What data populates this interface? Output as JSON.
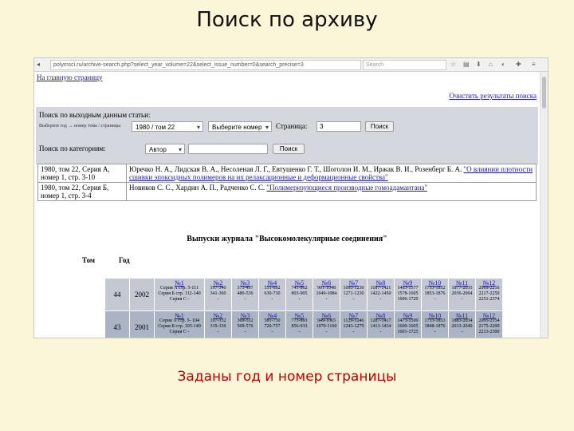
{
  "slide": {
    "title": "Поиск по архиву",
    "caption": "Заданы год и номер страницы"
  },
  "browser": {
    "url": "polymsci.ru/archive-search.php?select_year_volume=22&select_issue_number=0&search_precise=3",
    "search_placeholder": "Search"
  },
  "page": {
    "home_link": "На главную страницу",
    "clear_link": "Очистить результаты поиска",
    "output_search_label": "Поиск по выходным данным статьи:",
    "year_hint": "Выберите год → номер тома / страницы",
    "year_select": "1980 / том 22",
    "number_select": "Выберите номер",
    "page_label": "Страница:",
    "page_value": "3",
    "search_button": "Поиск",
    "category_label": "Поиск по категориям:",
    "category_select": "Автор",
    "category_input": "",
    "category_button": "Поиск"
  },
  "results": [
    {
      "ref": "1980, том 22, Серия А, номер 1, стр. 3-10",
      "authors": "Юречко Н. А., Лидская В. А., Несоленая Л. Г., Евтушенко Г. Т., Шоголон И. М., Иржак В. И., Розенберг Б. А.",
      "title": "\"О влиянии плотности сшивки эпоксидных полимеров на их релаксационные и деформационные свойства\""
    },
    {
      "ref": "1980, том 22, Серия Б, номер 1, стр. 3-4",
      "authors": "Новиков С. С., Хардин А. П., Радченко С. С.",
      "title": "\"Полимеризующиеся производные гомоадамантана\""
    }
  ],
  "issues": {
    "heading": "Выпуски журнала \"Высокомолекулярные соединения\"",
    "col_volume": "Том",
    "col_year": "Год",
    "rows": [
      {
        "volume": "44",
        "year": "2002",
        "cells": [
          {
            "no": "№1",
            "lines": [
              "Серия А стр. 5-111",
              "Серия Б стр. 112-140",
              "Серия С -"
            ]
          },
          {
            "no": "№2",
            "lines": [
              "197-340",
              "341-360",
              "-"
            ]
          },
          {
            "no": "№3",
            "lines": [
              "373-497",
              "480-536",
              "-"
            ]
          },
          {
            "no": "№4",
            "lines": [
              "551-692",
              "630-730",
              "-"
            ]
          },
          {
            "no": "№5",
            "lines": [
              "741-862",
              "803-905",
              "-"
            ]
          },
          {
            "no": "№6",
            "lines": [
              "901-1048",
              "1049-1084",
              "-"
            ]
          },
          {
            "no": "№7",
            "lines": [
              "1093-1230",
              "1271-1230",
              "-"
            ]
          },
          {
            "no": "№8",
            "lines": [
              "1187-1421",
              "1422-1450",
              "-"
            ]
          },
          {
            "no": "№9",
            "lines": [
              "1463-1577",
              "1578-1605",
              "1606-1720"
            ]
          },
          {
            "no": "№10",
            "lines": [
              "1733-1852",
              "1853-1876",
              "-"
            ]
          },
          {
            "no": "№11",
            "lines": [
              "1877-2035",
              "2036-2064",
              "-"
            ]
          },
          {
            "no": "№12",
            "lines": [
              "2069-2216",
              "2217-2250",
              "2251-2374"
            ]
          }
        ]
      },
      {
        "volume": "43",
        "year": "2001",
        "cells": [
          {
            "no": "№1",
            "lines": [
              "Серия А стр. 5- 104",
              "Серия Б стр. 105-140",
              "Серия С -"
            ]
          },
          {
            "no": "№2",
            "lines": [
              "197-332",
              "319-336",
              "-"
            ]
          },
          {
            "no": "№3",
            "lines": [
              "369-532",
              "509-576",
              "-"
            ]
          },
          {
            "no": "№4",
            "lines": [
              "581-730",
              "720-757",
              "-"
            ]
          },
          {
            "no": "№5",
            "lines": [
              "773-893",
              "856-933",
              "-"
            ]
          },
          {
            "no": "№6",
            "lines": [
              "949-1065",
              "1070-1160",
              "-"
            ]
          },
          {
            "no": "№7",
            "lines": [
              "1129-1246",
              "1243-1279",
              "-"
            ]
          },
          {
            "no": "№8",
            "lines": [
              "1287-1417",
              "1413-1434",
              "-"
            ]
          },
          {
            "no": "№9",
            "lines": [
              "1473-1599",
              "1600-1605",
              "1601-1725"
            ]
          },
          {
            "no": "№10",
            "lines": [
              "1733-1853",
              "1848-1876",
              "-"
            ]
          },
          {
            "no": "№11",
            "lines": [
              "1883-2034",
              "2013-2040",
              "-"
            ]
          },
          {
            "no": "№12",
            "lines": [
              "2095-2154",
              "2175-2200",
              "2213-2300"
            ]
          }
        ]
      }
    ]
  }
}
